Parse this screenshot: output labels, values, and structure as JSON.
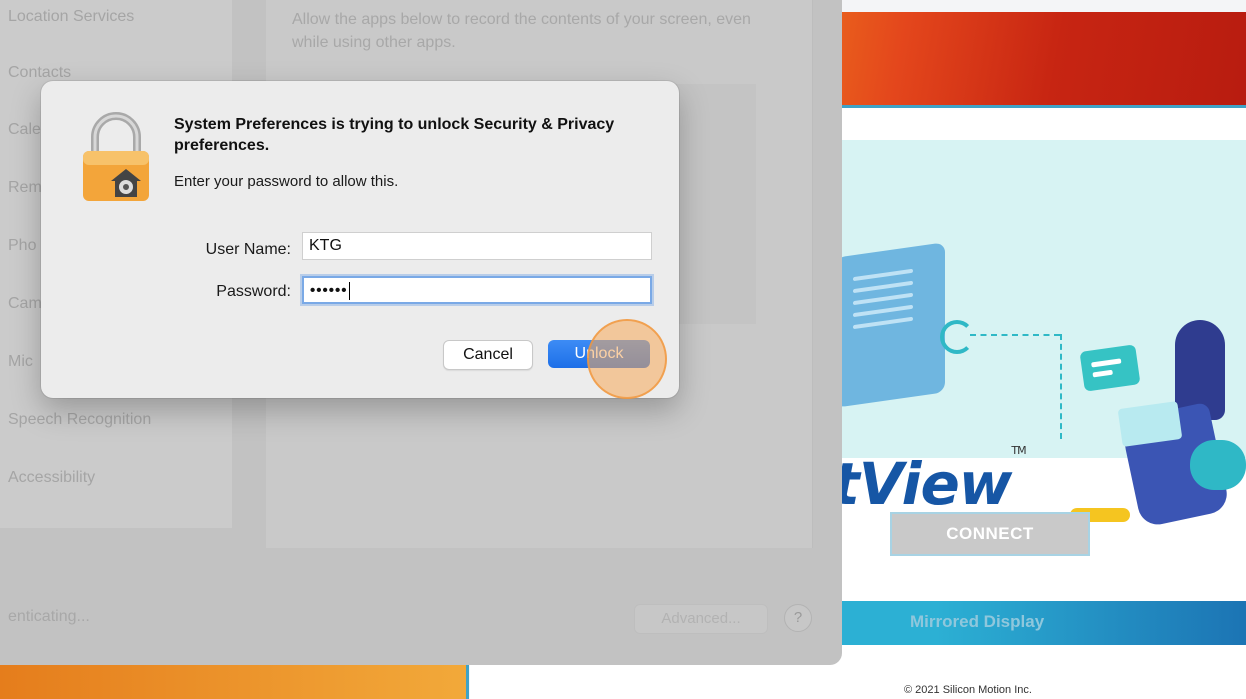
{
  "background_app": {
    "brand_name": "tView",
    "brand_tm": "TM",
    "connect_label": "CONNECT",
    "mirror_label": "Mirrored Display",
    "copyright": "© 2021 Silicon Motion Inc."
  },
  "prefs": {
    "sidebar_items": [
      "Location Services",
      "Contacts",
      "Cale",
      "Rem",
      "Pho",
      "Cam",
      "Mic",
      "Speech Recognition",
      "Accessibility"
    ],
    "panel_description": "Allow the apps below to record the contents of your screen, even while using other apps.",
    "status_text": "enticating...",
    "advanced_label": "Advanced...",
    "help_label": "?"
  },
  "dialog": {
    "title": "System Preferences is trying to unlock Security & Privacy preferences.",
    "subtitle": "Enter your password to allow this.",
    "username_label": "User Name:",
    "username_value": "KTG",
    "password_label": "Password:",
    "password_value": "••••••",
    "cancel_label": "Cancel",
    "unlock_label": "Unlock",
    "icon": "lock-icon"
  },
  "colors": {
    "accent_blue": "#1d6fe8",
    "click_highlight": "#f7aa5a",
    "brand_blue": "#1656a5"
  }
}
